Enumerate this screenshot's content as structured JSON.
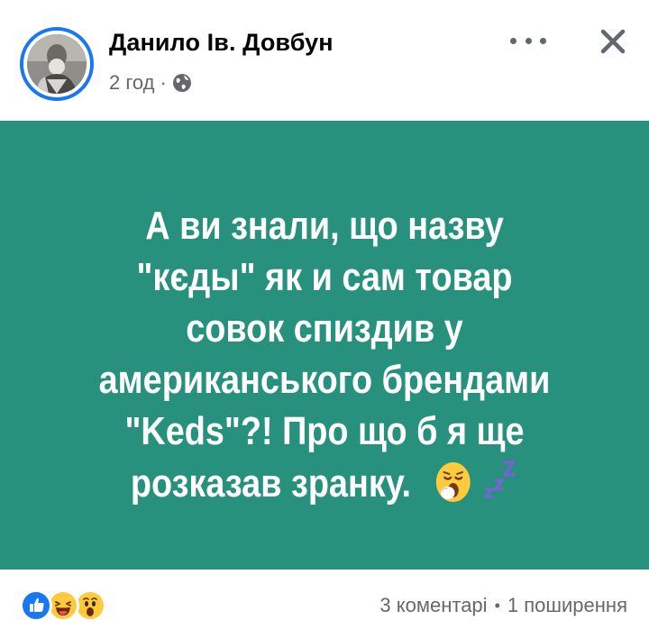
{
  "post": {
    "author": "Данило Ів. Довбун",
    "time": "2 год",
    "separator": "·",
    "privacy_icon": "globe-icon",
    "lines": [
      "А ви знали, що назву",
      "\"кєды\" як и сам товар",
      "совок спиздив у",
      "американського брендами",
      "\"Keds\"?! Про що б я ще",
      "розказав зранку."
    ],
    "emojis": [
      "yawning-face-emoji",
      "zzz-emoji"
    ],
    "background_color": "#27917e",
    "text_color": "#ffffff"
  },
  "header": {
    "more_icon": "more-icon",
    "close_icon": "close-icon"
  },
  "footer": {
    "reactions": [
      "like-icon",
      "laugh-icon",
      "wow-icon"
    ],
    "comments": "3 коментарі",
    "separator": "•",
    "shares": "1 поширення"
  }
}
